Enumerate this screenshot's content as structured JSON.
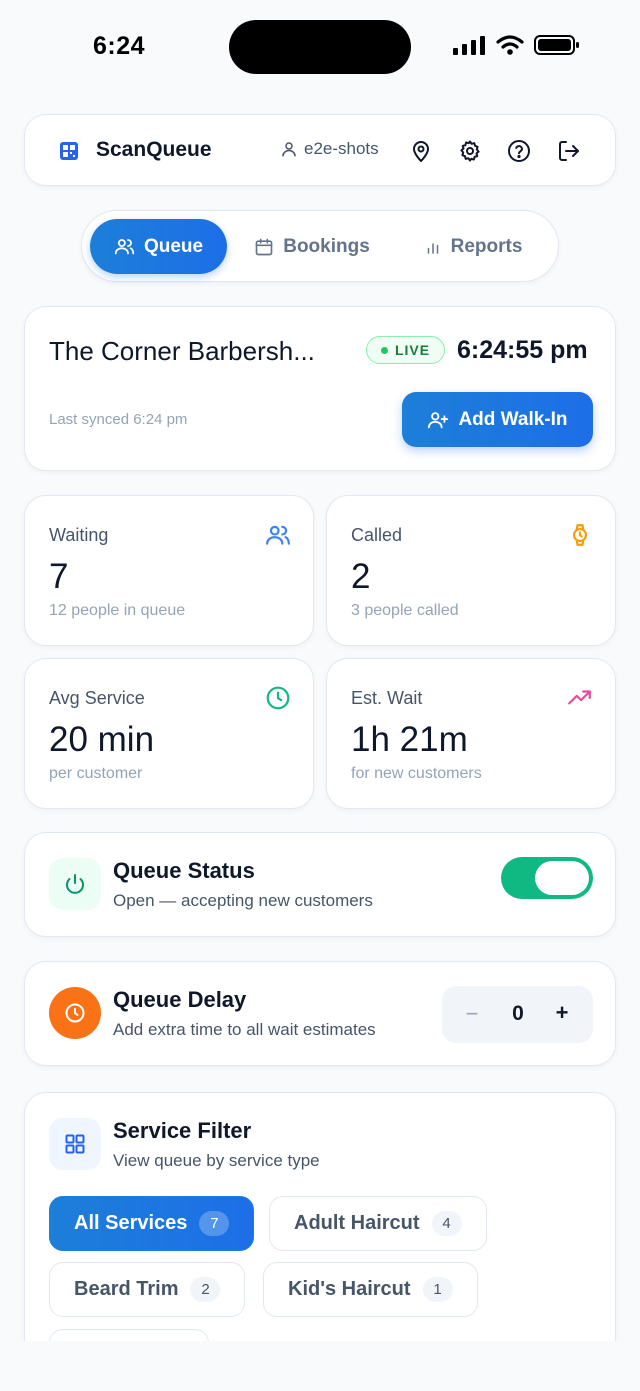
{
  "status_bar": {
    "time": "6:24"
  },
  "header": {
    "brand": "ScanQueue",
    "user": "e2e-shots",
    "icons": [
      "map-pin-icon",
      "gear-icon",
      "help-icon",
      "logout-icon"
    ]
  },
  "nav": {
    "tabs": [
      {
        "label": "Queue",
        "icon": "users-icon",
        "active": true
      },
      {
        "label": "Bookings",
        "icon": "calendar-icon",
        "active": false
      },
      {
        "label": "Reports",
        "icon": "bar-chart-icon",
        "active": false
      }
    ]
  },
  "shop": {
    "name": "The Corner Barbersh...",
    "live_label": "LIVE",
    "clock": "6:24:55 pm",
    "last_synced": "Last synced 6:24 pm",
    "add_button": "Add Walk-In"
  },
  "stats": [
    {
      "label": "Waiting",
      "value": "7",
      "sub": "12 people in queue",
      "icon": "users-icon",
      "color": "#3b82f6"
    },
    {
      "label": "Called",
      "value": "2",
      "sub": "3 people called",
      "icon": "watch-icon",
      "color": "#f59e0b"
    },
    {
      "label": "Avg Service",
      "value": "20 min",
      "sub": "per customer",
      "icon": "clock-icon",
      "color": "#10b981"
    },
    {
      "label": "Est. Wait",
      "value": "1h 21m",
      "sub": "for new customers",
      "icon": "trending-up-icon",
      "color": "#ec4899"
    }
  ],
  "queue_status": {
    "title": "Queue Status",
    "desc": "Open — accepting new customers",
    "enabled": true
  },
  "queue_delay": {
    "title": "Queue Delay",
    "desc": "Add extra time to all wait estimates",
    "minus": "−",
    "value": "0",
    "plus": "+"
  },
  "service_filter": {
    "title": "Service Filter",
    "desc": "View queue by service type",
    "chips": [
      {
        "label": "All Services",
        "count": "7",
        "active": true
      },
      {
        "label": "Adult Haircut",
        "count": "4",
        "active": false
      },
      {
        "label": "Beard Trim",
        "count": "2",
        "active": false
      },
      {
        "label": "Kid's Haircut",
        "count": "1",
        "active": false
      }
    ]
  },
  "colors": {
    "primary": "#1d6ee8",
    "success": "#10b981",
    "accent_orange": "#f59e0b"
  }
}
